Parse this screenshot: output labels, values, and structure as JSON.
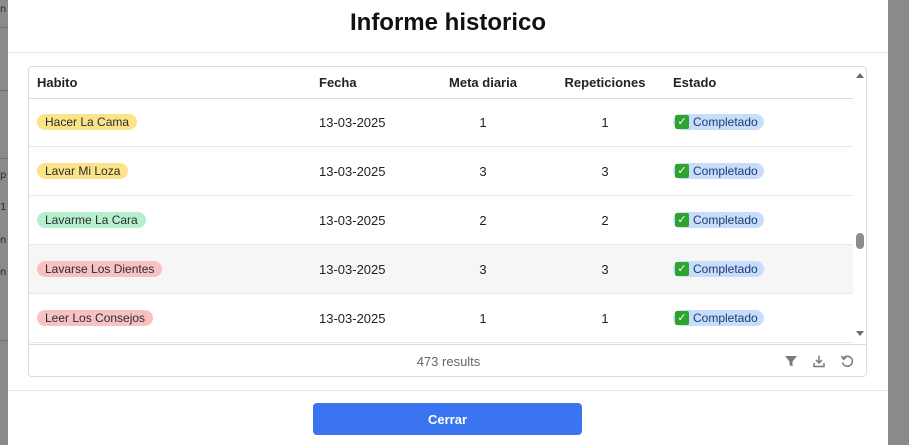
{
  "modal": {
    "title": "Informe historico",
    "close_label": "Cerrar"
  },
  "table": {
    "columns": [
      "Habito",
      "Fecha",
      "Meta diaria",
      "Repeticiones",
      "Estado"
    ],
    "rows": [
      {
        "habit": "Hacer La Cama",
        "habit_color": "#fbe38a",
        "date": "13-03-2025",
        "goal": "1",
        "reps": "1",
        "status": "Completado"
      },
      {
        "habit": "Lavar Mi Loza",
        "habit_color": "#fbe38a",
        "date": "13-03-2025",
        "goal": "3",
        "reps": "3",
        "status": "Completado"
      },
      {
        "habit": "Lavarme La Cara",
        "habit_color": "#b6efcf",
        "date": "13-03-2025",
        "goal": "2",
        "reps": "2",
        "status": "Completado"
      },
      {
        "habit": "Lavarse Los Dientes",
        "habit_color": "#f8c2c2",
        "date": "13-03-2025",
        "goal": "3",
        "reps": "3",
        "status": "Completado"
      },
      {
        "habit": "Leer Los Consejos",
        "habit_color": "#f8c2c2",
        "date": "13-03-2025",
        "goal": "1",
        "reps": "1",
        "status": "Completado"
      }
    ],
    "status_icon": "check-box-icon",
    "results_text": "473 results",
    "footer_icons": [
      "filter-icon",
      "download-icon",
      "reset-icon"
    ]
  },
  "colors": {
    "primary": "#3b74f0",
    "status_bg": "#c7ddfb",
    "check_green": "#2ea32e"
  },
  "background": {
    "glyphs": [
      "n",
      "p",
      "1",
      "n",
      "n"
    ]
  }
}
